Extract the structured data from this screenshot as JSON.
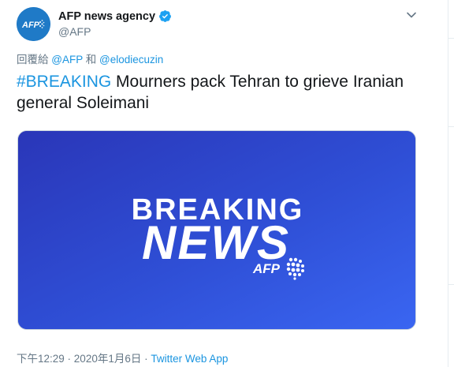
{
  "account": {
    "display_name": "AFP news agency",
    "handle": "@AFP",
    "avatar_logo_text": "AFP",
    "verified": true
  },
  "reply_context": {
    "prefix": "回覆給",
    "mention_1": "@AFP",
    "joiner": "和",
    "mention_2": "@elodiecuzin"
  },
  "tweet": {
    "hashtag": "#BREAKING",
    "text": " Mourners pack Tehran to grieve Iranian general Soleimani"
  },
  "media": {
    "headline_line_1": "BREAKING",
    "headline_line_2": "NEWS",
    "logo_text": "AFP"
  },
  "meta": {
    "time": "下午12:29",
    "separator_1": " · ",
    "date": "2020年1月6日",
    "separator_2": " · ",
    "source": "Twitter Web App"
  },
  "icons": {
    "verified": "verified-badge-icon",
    "menu": "chevron-down-icon"
  },
  "colors": {
    "link": "#1b95e0",
    "text": "#14171a",
    "muted": "#657786",
    "avatar_bg": "#1f7ac7",
    "media_gradient_start": "#2a36b8",
    "media_gradient_end": "#3a66f2"
  }
}
